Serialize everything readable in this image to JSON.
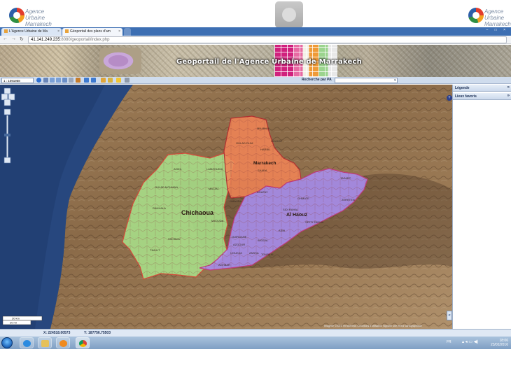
{
  "browser": {
    "tabs": [
      {
        "label": "L'Agence Urbaine de Ma",
        "active": false
      },
      {
        "label": "Géoportail des plans d'am",
        "active": true
      }
    ],
    "window_controls": "– □ ×",
    "url_host": "41.141.249.235",
    "url_rest": ":8080/geoportail/index.php"
  },
  "header": {
    "logo_text_line1": "Agence Urbaine",
    "logo_text_line2": "Marrakech",
    "title": "Geoportail de l'Agence Urbaine de Marrakech"
  },
  "toolbar": {
    "scale_value": "1 : 1091958",
    "search_label": "Recherche par PA",
    "search_value": ""
  },
  "panel": {
    "legend_label": "Légende",
    "favorites_label": "Lieux favoris"
  },
  "map": {
    "scale_bar_top": "30 km",
    "scale_bar_bottom": "20 mi",
    "attribution": "Imagerie ©2016 TerraMetrics    Conditions d'utilisation    Signaler une erreur cartographique",
    "colors": {
      "chichaoua": "#a8e08a",
      "marrakech": "#f08455",
      "al_haouz": "#a88ef0",
      "sea": "#27477e"
    },
    "province_labels": [
      "Chichaoua",
      "Marrakech",
      "Al Haouz"
    ],
    "commune_labels": {
      "chichaoua": [
        "AHDIL",
        "LAMZOUDIA",
        "OULAD MOUMNA",
        "MAJJAT",
        "RAHHALA",
        "GMASSA",
        "MZOUDA",
        "TIMLILT",
        "SIDI BOU"
      ],
      "marrakech": [
        "MNABHA",
        "OUAHAT",
        "OULAD DLIM",
        "HARBIL",
        "SAADA",
        "AGAFAY"
      ],
      "al_haouz": [
        "TAZART",
        "ZERKTEN",
        "GHMATE",
        "SIDI RAHAL",
        "OUIRGANE",
        "AZGOUR",
        "ASNI",
        "IMGDAL",
        "IJOUKAK",
        "ANSSA",
        "TOUBKAL",
        "AGHBAR",
        "SETTI FADMA"
      ]
    }
  },
  "status": {
    "x_coord": "X: 224518.00573",
    "y_coord": "Y: 187756.75503"
  },
  "taskbar": {
    "lang": "FR",
    "time": "18:06",
    "date": "23/02/2016"
  }
}
